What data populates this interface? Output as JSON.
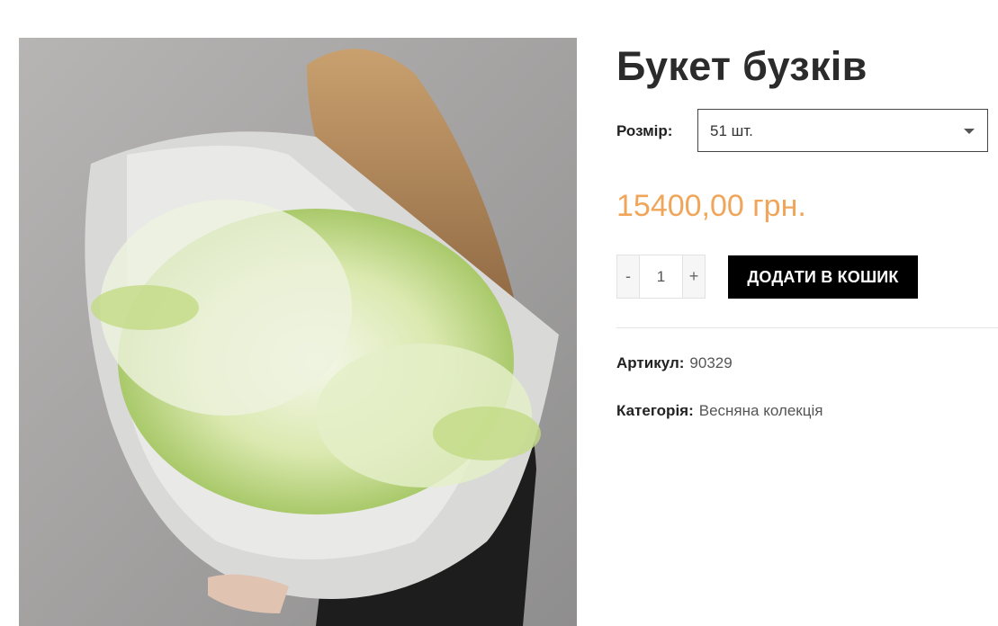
{
  "product": {
    "title": "Букет бузків",
    "size_label": "Розмір:",
    "size_selected": "51 шт.",
    "price": "15400,00 грн.",
    "quantity": {
      "minus": "-",
      "value": "1",
      "plus": "+"
    },
    "add_to_cart": "ДОДАТИ В КОШИК",
    "sku_label": "Артикул:",
    "sku_value": "90329",
    "category_label": "Категорія:",
    "category_value": "Весняна колекція"
  },
  "colors": {
    "price": "#f0a65a",
    "button_bg": "#000000",
    "button_text": "#ffffff"
  },
  "icons": {
    "select_caret": "chevron-down-icon"
  }
}
